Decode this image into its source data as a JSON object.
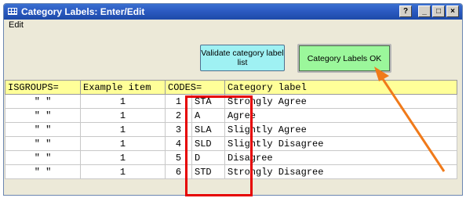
{
  "window": {
    "title": "Category Labels: Enter/Edit",
    "help_glyph": "?",
    "min_glyph": "_",
    "max_glyph": "□",
    "close_glyph": "×"
  },
  "menu": {
    "edit": "Edit"
  },
  "buttons": {
    "validate": "Validate category label list",
    "ok": "Category Labels OK"
  },
  "table": {
    "headers": [
      "ISGROUPS=",
      "Example item",
      "CODES=",
      "Category label"
    ],
    "rows": [
      {
        "isgroups": "\" \"",
        "example": "1",
        "code": "1",
        "abbr": "STA",
        "label": "Strongly Agree"
      },
      {
        "isgroups": "\" \"",
        "example": "1",
        "code": "2",
        "abbr": "A",
        "label": "Agree"
      },
      {
        "isgroups": "\" \"",
        "example": "1",
        "code": "3",
        "abbr": "SLA",
        "label": "Slightly Agree"
      },
      {
        "isgroups": "\" \"",
        "example": "1",
        "code": "4",
        "abbr": "SLD",
        "label": "Slightly Disagree"
      },
      {
        "isgroups": "\" \"",
        "example": "1",
        "code": "5",
        "abbr": "D",
        "label": "Disagree"
      },
      {
        "isgroups": "\" \"",
        "example": "1",
        "code": "6",
        "abbr": "STD",
        "label": "Strongly Disagree"
      }
    ]
  },
  "colors": {
    "titlebar": "#2c5bc2",
    "header_bg": "#ffff99",
    "validate_bg": "#9ff1f3",
    "ok_bg": "#9bf79b",
    "highlight": "#e60000",
    "arrow": "#f07a1a"
  }
}
